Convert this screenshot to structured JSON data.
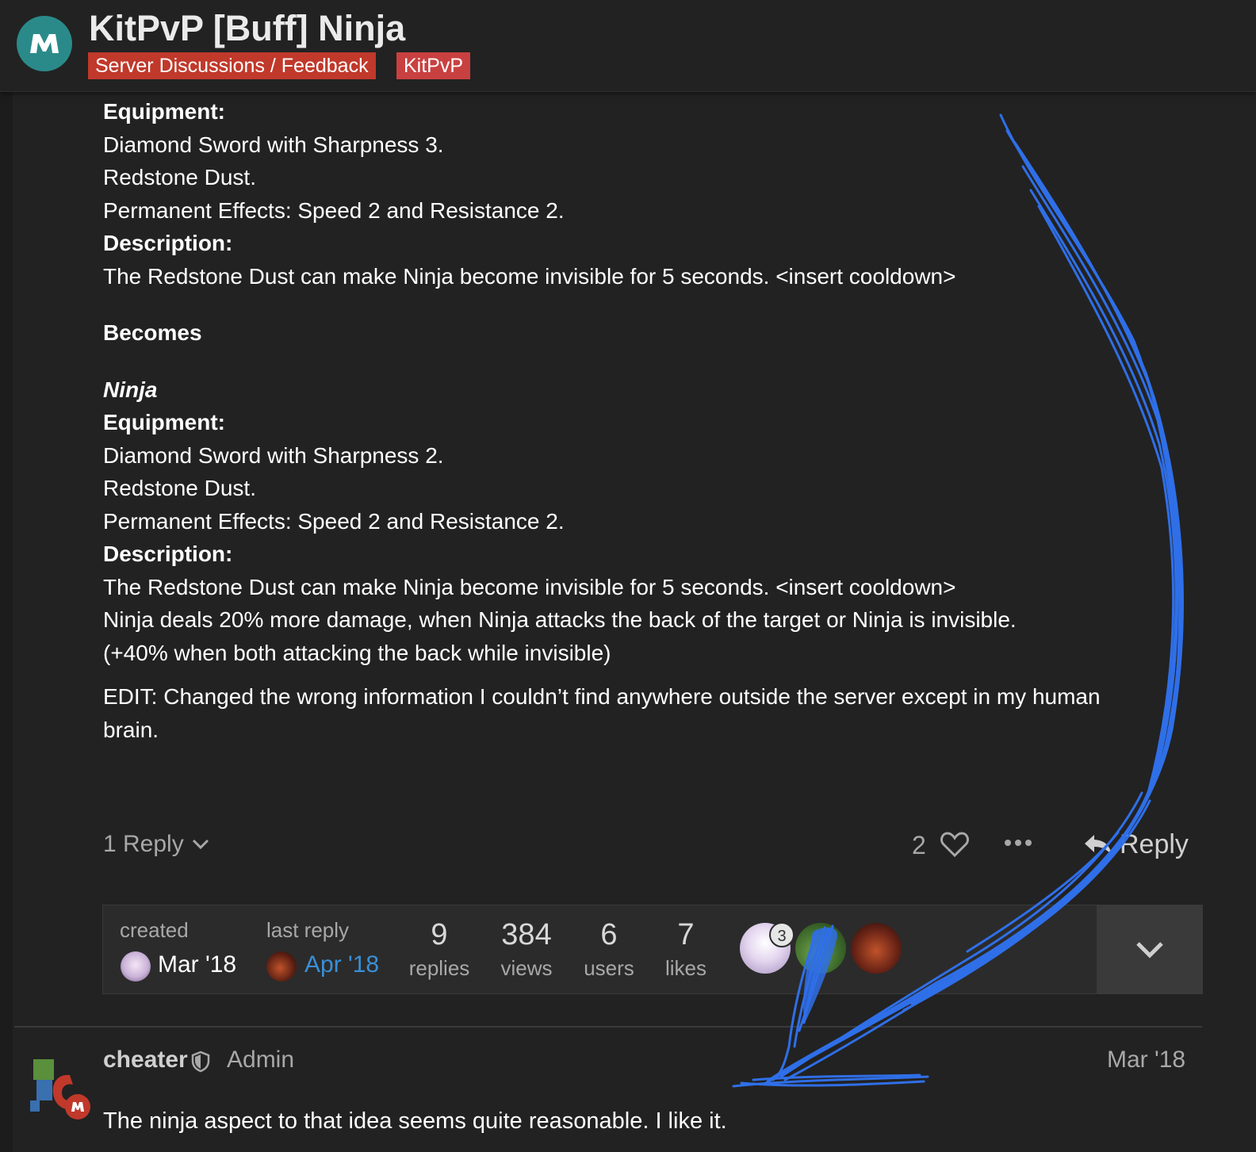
{
  "header": {
    "title": "KitPvP [Buff] Ninja",
    "categories": [
      "Server Discussions / Feedback",
      "KitPvP"
    ],
    "logo_icon": "logo-icon"
  },
  "post": {
    "lines": {
      "equipment_1": "Equipment:",
      "item_1a": "Diamond Sword with Sharpness 3.",
      "item_1b": "Redstone Dust.",
      "item_1c": "Permanent Effects: Speed 2 and Resistance 2.",
      "description_1": "Description:",
      "desc_1": "The Redstone Dust can make Ninja become invisible for 5 seconds. <insert cooldown>",
      "becomes": "Becomes",
      "ninja": "Ninja",
      "equipment_2": "Equipment:",
      "item_2a": "Diamond Sword with Sharpness 2.",
      "item_2b": "Redstone Dust.",
      "item_2c": "Permanent Effects: Speed 2 and Resistance 2.",
      "description_2": "Description:",
      "desc_2a": "The Redstone Dust can make Ninja become invisible for 5 seconds. <insert cooldown>",
      "desc_2b": "Ninja deals 20% more damage, when Ninja attacks the back of the target or Ninja is invisible.",
      "desc_2c": "(+40% when both attacking the back while invisible)",
      "edit_1": "EDIT: Changed the wrong information I couldn’t find anywhere outside the server except in my human",
      "edit_2": "brain."
    }
  },
  "actions": {
    "reply_count": "1 Reply",
    "like_count": "2",
    "reply_label": "Reply"
  },
  "topic_map": {
    "created_label": "created",
    "created_date": "Mar '18",
    "last_reply_label": "last reply",
    "last_reply_date": "Apr '18",
    "stats": [
      {
        "value": "9",
        "label": "replies"
      },
      {
        "value": "384",
        "label": "views"
      },
      {
        "value": "6",
        "label": "users"
      },
      {
        "value": "7",
        "label": "likes"
      }
    ],
    "badge": "3"
  },
  "next_post": {
    "username": "cheater",
    "user_title": "Admin",
    "date": "Mar '18",
    "text": "The ninja aspect to that idea seems quite reasonable. I like it."
  },
  "colors": {
    "background": "#222222",
    "category_red": "#c0392b",
    "link_blue": "#3a8fd6",
    "scribble_blue": "#2f6fe8"
  }
}
